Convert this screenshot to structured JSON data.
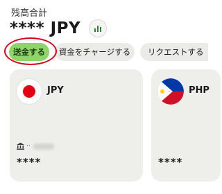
{
  "header": {
    "balance_label": "残高合計",
    "balance_amount": "**** JPY",
    "chart_button_icon": "bar-chart-icon"
  },
  "actions": [
    {
      "label": "送金する",
      "highlighted": true
    },
    {
      "label": "資金をチャージする"
    },
    {
      "label": "リクエストする"
    }
  ],
  "cards": [
    {
      "currency": "JPY",
      "flag_icon": "japan-flag-icon",
      "account_icon": "bank-icon",
      "account_prefix": "··",
      "amount": "****"
    },
    {
      "currency": "PHP",
      "flag_icon": "philippines-flag-icon",
      "amount": "****"
    }
  ],
  "colors": {
    "primary_button": "#8fd468",
    "secondary_button": "#ebebe8",
    "card_background": "#eeeeea",
    "highlight_ring": "#d9001b"
  }
}
